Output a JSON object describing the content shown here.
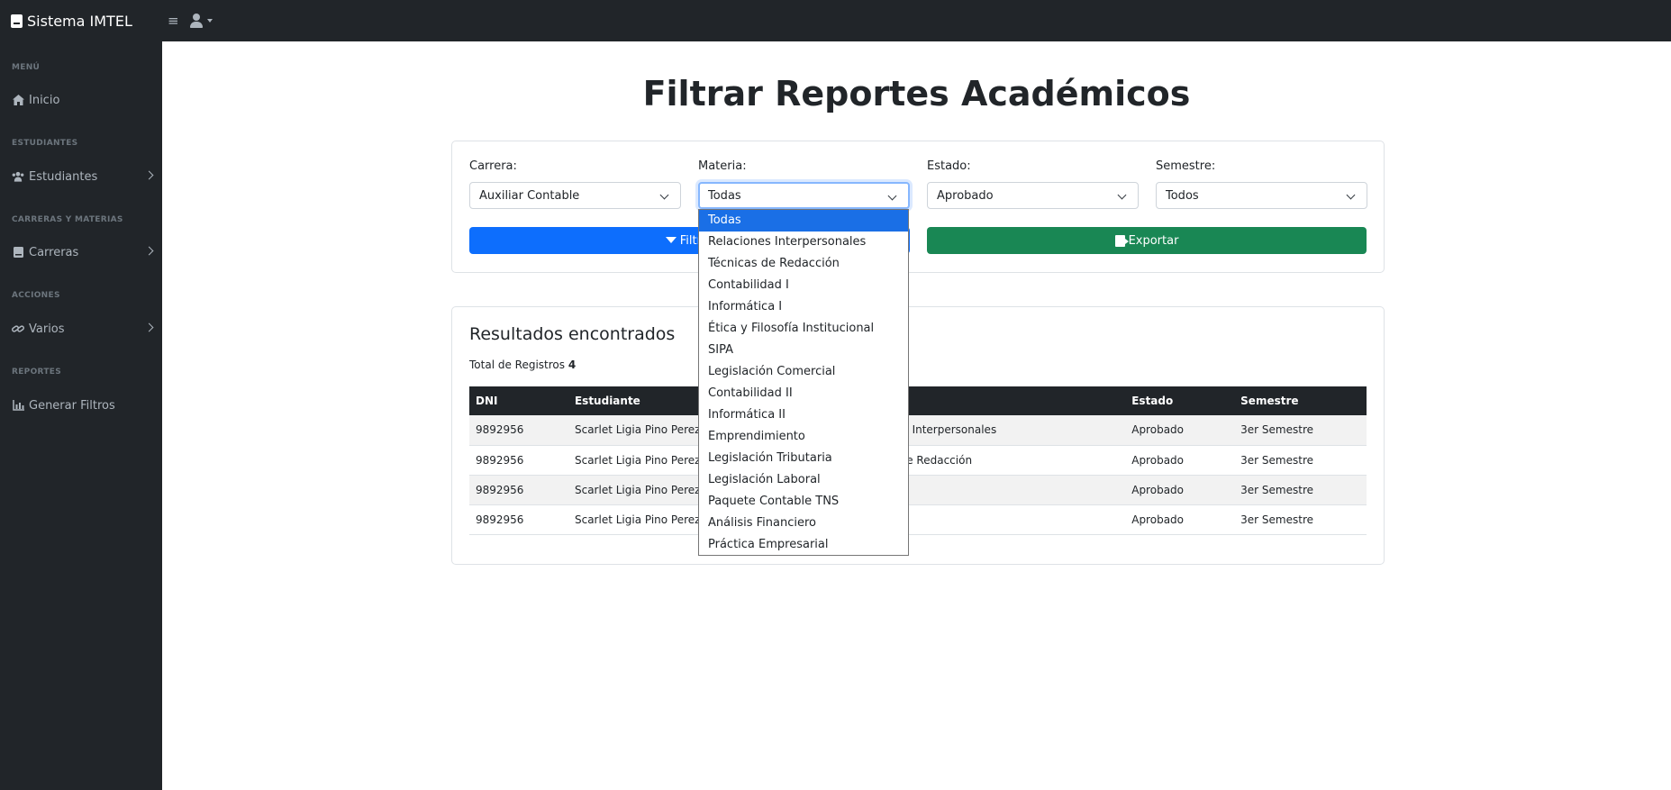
{
  "header": {
    "brand": "Sistema IMTEL",
    "menu_glyph": "≡"
  },
  "sidebar": {
    "sections": [
      {
        "heading": "MENÚ",
        "item": "Inicio",
        "icon": "home-icon",
        "chevron": false
      },
      {
        "heading": "ESTUDIANTES",
        "item": "Estudiantes",
        "icon": "users-icon",
        "chevron": true
      },
      {
        "heading": "CARRERAS Y MATERIAS",
        "item": "Carreras",
        "icon": "book-icon",
        "chevron": true
      },
      {
        "heading": "ACCIONES",
        "item": "Varios",
        "icon": "link-icon",
        "chevron": true
      },
      {
        "heading": "REPORTES",
        "item": "Generar Filtros",
        "icon": "chart-icon",
        "chevron": false
      }
    ]
  },
  "page": {
    "title": "Filtrar Reportes Académicos"
  },
  "filters": {
    "carrera": {
      "label": "Carrera:",
      "value": "Auxiliar Contable"
    },
    "materia": {
      "label": "Materia:",
      "value": "Todas"
    },
    "estado": {
      "label": "Estado:",
      "value": "Aprobado"
    },
    "semestre": {
      "label": "Semestre:",
      "value": "Todos"
    },
    "filter_button": "Filtrar",
    "export_button": "Exportar"
  },
  "dropdown": {
    "selected": "Todas",
    "options": [
      "Todas",
      "Relaciones Interpersonales",
      "Técnicas de Redacción",
      "Contabilidad I",
      "Informática I",
      "Ética y Filosofía Institucional",
      "SIPA",
      "Legislación Comercial",
      "Contabilidad II",
      "Informática II",
      "Emprendimiento",
      "Legislación Tributaria",
      "Legislación Laboral",
      "Paquete Contable TNS",
      "Análisis Financiero",
      "Práctica Empresarial"
    ]
  },
  "results": {
    "title": "Resultados encontrados",
    "total_label": "Total de Registros",
    "total_value": "4",
    "columns": [
      "DNI",
      "Estudiante",
      "",
      "Estado",
      "Semestre"
    ],
    "rows": [
      [
        "9892956",
        "Scarlet Ligia Pino Perez",
        "Relaciones Interpersonales",
        "Aprobado",
        "3er Semestre"
      ],
      [
        "9892956",
        "Scarlet Ligia Pino Perez",
        "Técnicas de Redacción",
        "Aprobado",
        "3er Semestre"
      ],
      [
        "9892956",
        "Scarlet Ligia Pino Perez",
        "",
        "Aprobado",
        "3er Semestre"
      ],
      [
        "9892956",
        "Scarlet Ligia Pino Perez",
        "",
        "Aprobado",
        "3er Semestre"
      ]
    ]
  }
}
